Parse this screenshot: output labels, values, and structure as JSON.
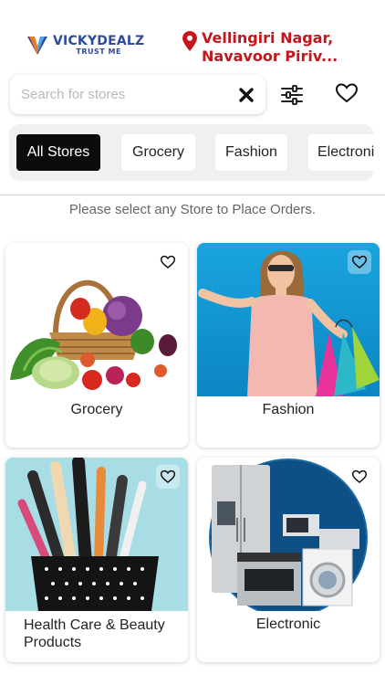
{
  "brand": {
    "name": "VICKYDEALZ",
    "tagline": "TRUST ME",
    "colors": {
      "blue": "#2e4a9a",
      "orange": "#f07a22",
      "red": "#c4161c"
    }
  },
  "location": {
    "line1": "Vellingiri Nagar,",
    "line2": "Navavoor Piriv..."
  },
  "search": {
    "placeholder": "Search for stores",
    "value": ""
  },
  "icons": {
    "clear": "close-icon",
    "filter": "sliders-icon",
    "wishlist": "heart-icon",
    "location": "map-pin-icon"
  },
  "categories": [
    {
      "label": "All Stores",
      "active": true
    },
    {
      "label": "Grocery",
      "active": false
    },
    {
      "label": "Fashion",
      "active": false
    },
    {
      "label": "Electronic",
      "active": false
    }
  ],
  "hint": "Please select any Store to Place Orders.",
  "stores": [
    {
      "label": "Grocery"
    },
    {
      "label": "Fashion"
    },
    {
      "label": "Health Care & Beauty Products"
    },
    {
      "label": "Electronic"
    }
  ]
}
